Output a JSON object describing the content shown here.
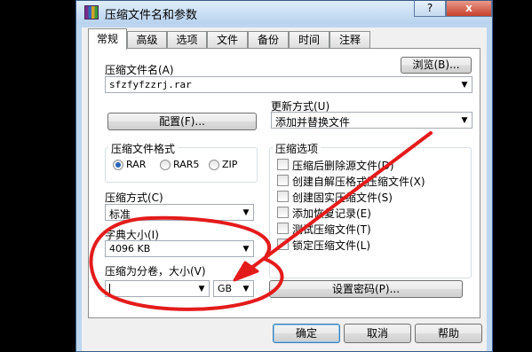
{
  "window": {
    "title": "压缩文件名和参数",
    "caption_help": "?",
    "caption_close": "x"
  },
  "tabs": [
    "常规",
    "高级",
    "选项",
    "文件",
    "备份",
    "时间",
    "注释"
  ],
  "archive_name": {
    "label": "压缩文件名(A)",
    "value": "sfzfyfzzrj.rar",
    "browse_button": "浏览(B)..."
  },
  "update_mode": {
    "label": "更新方式(U)",
    "value": "添加并替换文件"
  },
  "profile_button": "配置(F)...",
  "format": {
    "title": "压缩文件格式",
    "options": [
      "RAR",
      "RAR5",
      "ZIP"
    ],
    "selected": "RAR"
  },
  "method": {
    "label": "压缩方式(C)",
    "value": "标准"
  },
  "dictionary": {
    "label": "字典大小(I)",
    "value": "4096 KB"
  },
  "volume": {
    "label": "压缩为分卷，大小(V)",
    "value": "",
    "unit": "GB"
  },
  "options": {
    "title": "压缩选项",
    "items": [
      "压缩后删除源文件(D)",
      "创建自解压格式压缩文件(X)",
      "创建固实压缩文件(S)",
      "添加恢复记录(E)",
      "测试压缩文件(T)",
      "锁定压缩文件(L)"
    ]
  },
  "password_button": "设置密码(P)...",
  "footer": {
    "ok": "确定",
    "cancel": "取消",
    "help": "帮助"
  },
  "annotation_color": "#e41b1b"
}
